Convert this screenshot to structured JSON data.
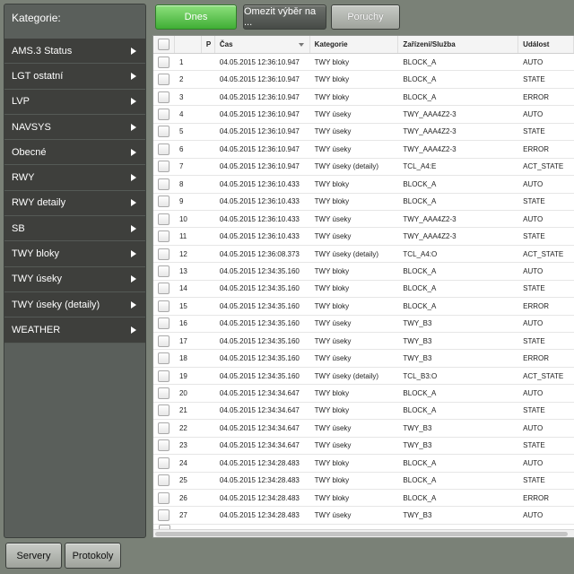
{
  "sidebar": {
    "title": "Kategorie:",
    "items": [
      {
        "label": "AMS.3 Status"
      },
      {
        "label": "LGT ostatní"
      },
      {
        "label": "LVP"
      },
      {
        "label": "NAVSYS"
      },
      {
        "label": "Obecné"
      },
      {
        "label": "RWY"
      },
      {
        "label": "RWY detaily"
      },
      {
        "label": "SB"
      },
      {
        "label": "TWY bloky"
      },
      {
        "label": "TWY úseky"
      },
      {
        "label": "TWY úseky (detaily)"
      },
      {
        "label": "WEATHER"
      }
    ]
  },
  "bottom_buttons": {
    "servers": "Servery",
    "protocols": "Protokoly"
  },
  "filters": {
    "today": "Dnes",
    "limit": "Omezit výběr na ...",
    "faults": "Poruchy",
    "colors": {
      "active": "#3fae35",
      "dark": "#474b47",
      "light": "#9fa39c"
    }
  },
  "table": {
    "columns": {
      "p": "P",
      "time": "Čas",
      "category": "Kategorie",
      "device": "Zařízení/Služba",
      "event": "Událost"
    },
    "rows": [
      {
        "n": "1",
        "time": "04.05.2015 12:36:10.947",
        "cat": "TWY bloky",
        "dev": "BLOCK_A",
        "evt": "AUTO"
      },
      {
        "n": "2",
        "time": "04.05.2015 12:36:10.947",
        "cat": "TWY bloky",
        "dev": "BLOCK_A",
        "evt": "STATE"
      },
      {
        "n": "3",
        "time": "04.05.2015 12:36:10.947",
        "cat": "TWY bloky",
        "dev": "BLOCK_A",
        "evt": "ERROR"
      },
      {
        "n": "4",
        "time": "04.05.2015 12:36:10.947",
        "cat": "TWY úseky",
        "dev": "TWY_AAA4Z2-3",
        "evt": "AUTO"
      },
      {
        "n": "5",
        "time": "04.05.2015 12:36:10.947",
        "cat": "TWY úseky",
        "dev": "TWY_AAA4Z2-3",
        "evt": "STATE"
      },
      {
        "n": "6",
        "time": "04.05.2015 12:36:10.947",
        "cat": "TWY úseky",
        "dev": "TWY_AAA4Z2-3",
        "evt": "ERROR"
      },
      {
        "n": "7",
        "time": "04.05.2015 12:36:10.947",
        "cat": "TWY úseky (detaily)",
        "dev": "TCL_A4:E",
        "evt": "ACT_STATE"
      },
      {
        "n": "8",
        "time": "04.05.2015 12:36:10.433",
        "cat": "TWY bloky",
        "dev": "BLOCK_A",
        "evt": "AUTO"
      },
      {
        "n": "9",
        "time": "04.05.2015 12:36:10.433",
        "cat": "TWY bloky",
        "dev": "BLOCK_A",
        "evt": "STATE"
      },
      {
        "n": "10",
        "time": "04.05.2015 12:36:10.433",
        "cat": "TWY úseky",
        "dev": "TWY_AAA4Z2-3",
        "evt": "AUTO"
      },
      {
        "n": "11",
        "time": "04.05.2015 12:36:10.433",
        "cat": "TWY úseky",
        "dev": "TWY_AAA4Z2-3",
        "evt": "STATE"
      },
      {
        "n": "12",
        "time": "04.05.2015 12:36:08.373",
        "cat": "TWY úseky (detaily)",
        "dev": "TCL_A4:O",
        "evt": "ACT_STATE"
      },
      {
        "n": "13",
        "time": "04.05.2015 12:34:35.160",
        "cat": "TWY bloky",
        "dev": "BLOCK_A",
        "evt": "AUTO"
      },
      {
        "n": "14",
        "time": "04.05.2015 12:34:35.160",
        "cat": "TWY bloky",
        "dev": "BLOCK_A",
        "evt": "STATE"
      },
      {
        "n": "15",
        "time": "04.05.2015 12:34:35.160",
        "cat": "TWY bloky",
        "dev": "BLOCK_A",
        "evt": "ERROR"
      },
      {
        "n": "16",
        "time": "04.05.2015 12:34:35.160",
        "cat": "TWY úseky",
        "dev": "TWY_B3",
        "evt": "AUTO"
      },
      {
        "n": "17",
        "time": "04.05.2015 12:34:35.160",
        "cat": "TWY úseky",
        "dev": "TWY_B3",
        "evt": "STATE"
      },
      {
        "n": "18",
        "time": "04.05.2015 12:34:35.160",
        "cat": "TWY úseky",
        "dev": "TWY_B3",
        "evt": "ERROR"
      },
      {
        "n": "19",
        "time": "04.05.2015 12:34:35.160",
        "cat": "TWY úseky (detaily)",
        "dev": "TCL_B3:O",
        "evt": "ACT_STATE"
      },
      {
        "n": "20",
        "time": "04.05.2015 12:34:34.647",
        "cat": "TWY bloky",
        "dev": "BLOCK_A",
        "evt": "AUTO"
      },
      {
        "n": "21",
        "time": "04.05.2015 12:34:34.647",
        "cat": "TWY bloky",
        "dev": "BLOCK_A",
        "evt": "STATE"
      },
      {
        "n": "22",
        "time": "04.05.2015 12:34:34.647",
        "cat": "TWY úseky",
        "dev": "TWY_B3",
        "evt": "AUTO"
      },
      {
        "n": "23",
        "time": "04.05.2015 12:34:34.647",
        "cat": "TWY úseky",
        "dev": "TWY_B3",
        "evt": "STATE"
      },
      {
        "n": "24",
        "time": "04.05.2015 12:34:28.483",
        "cat": "TWY bloky",
        "dev": "BLOCK_A",
        "evt": "AUTO"
      },
      {
        "n": "25",
        "time": "04.05.2015 12:34:28.483",
        "cat": "TWY bloky",
        "dev": "BLOCK_A",
        "evt": "STATE"
      },
      {
        "n": "26",
        "time": "04.05.2015 12:34:28.483",
        "cat": "TWY bloky",
        "dev": "BLOCK_A",
        "evt": "ERROR"
      },
      {
        "n": "27",
        "time": "04.05.2015 12:34:28.483",
        "cat": "TWY úseky",
        "dev": "TWY_B3",
        "evt": "AUTO"
      }
    ]
  }
}
